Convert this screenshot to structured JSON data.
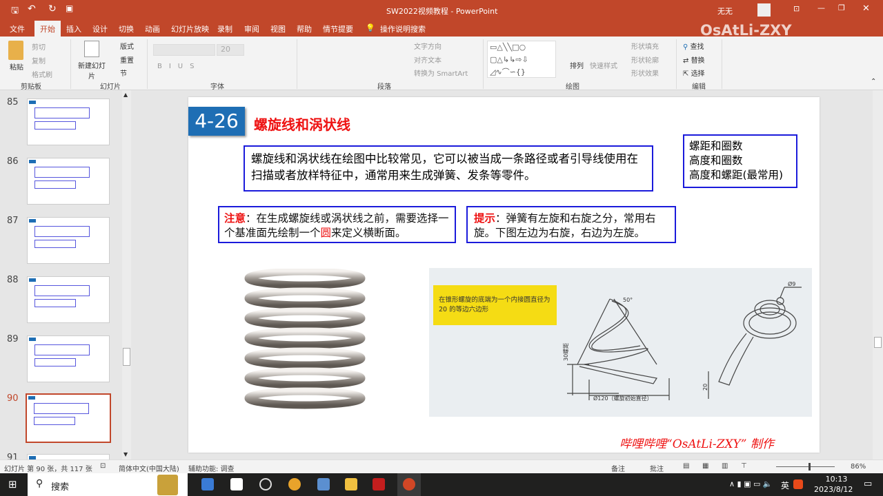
{
  "window": {
    "title": "SW2022视频教程 - PowerPoint",
    "user": "无无",
    "watermark": "OsAtLi-ZXY"
  },
  "tabs": [
    "文件",
    "开始",
    "插入",
    "设计",
    "切换",
    "动画",
    "幻灯片放映",
    "录制",
    "审阅",
    "视图",
    "帮助",
    "情节提要",
    "操作说明搜索"
  ],
  "ribbon": {
    "clipboard": {
      "label": "剪贴板",
      "paste": "粘贴",
      "cut": "剪切",
      "copy": "复制",
      "format_painter": "格式刷"
    },
    "slides": {
      "label": "幻灯片",
      "new_slide": "新建幻灯片",
      "layout": "版式",
      "reset": "重置",
      "section": "节"
    },
    "font": {
      "label": "字体",
      "size": "20"
    },
    "paragraph": {
      "label": "段落",
      "text_direction": "文字方向",
      "align_text": "对齐文本",
      "smartart": "转换为 SmartArt"
    },
    "drawing": {
      "label": "绘图",
      "arrange": "排列",
      "quick_styles": "快速样式",
      "fill": "形状填充",
      "outline": "形状轮廓",
      "effects": "形状效果"
    },
    "editing": {
      "label": "编辑",
      "find": "查找",
      "replace": "替换",
      "select": "选择"
    }
  },
  "thumbnails": [
    {
      "num": "85"
    },
    {
      "num": "86"
    },
    {
      "num": "87"
    },
    {
      "num": "88"
    },
    {
      "num": "89"
    },
    {
      "num": "90",
      "selected": true
    },
    {
      "num": "91"
    }
  ],
  "slide": {
    "badge": "4-26",
    "title": "螺旋线和涡状线",
    "intro": "螺旋线和涡状线在绘图中比较常见，它可以被当成一条路径或者引导线使用在扫描或者放样特征中，通常用来生成弹簧、发条等零件。",
    "options": [
      "螺距和圈数",
      "高度和圈数",
      "高度和螺距(最常用)"
    ],
    "note": {
      "label": "注意",
      "pre": "：在生成螺旋线或涡状线之前，需要选择一个基准面先绘制一个",
      "em": "圆",
      "post": "来定义横断面。"
    },
    "tip": {
      "label": "提示",
      "text": "：弹簧有左旋和右旋之分，常用右旋。下图左边为右旋，右边为左旋。"
    },
    "diagram": {
      "yellow_note": "在锥形螺旋的底端为一个内接圆直径为 20 的等边六边形",
      "angle": "50°",
      "pitch": "30螺距",
      "diameter": "Ø120（螺旋初始直径）",
      "wire": "Ø9",
      "height": "20"
    },
    "footer": "哔哩哔哩“OsAtLi-ZXY” 制作"
  },
  "status": {
    "slide_info": "幻灯片 第 90 张，共 117 张",
    "language": "简体中文(中国大陆)",
    "accessibility": "辅助功能: 调查",
    "notes": "备注",
    "comments": "批注",
    "zoom": "86%",
    "zoom_fraction": 0.55
  },
  "taskbar": {
    "search": "搜索",
    "time": "10:13",
    "date": "2023/8/12",
    "ime": "英"
  },
  "colors": {
    "accent": "#c1472a",
    "badge": "#1e6eb4",
    "box_border": "#1a1adb",
    "title_red": "#e11"
  }
}
